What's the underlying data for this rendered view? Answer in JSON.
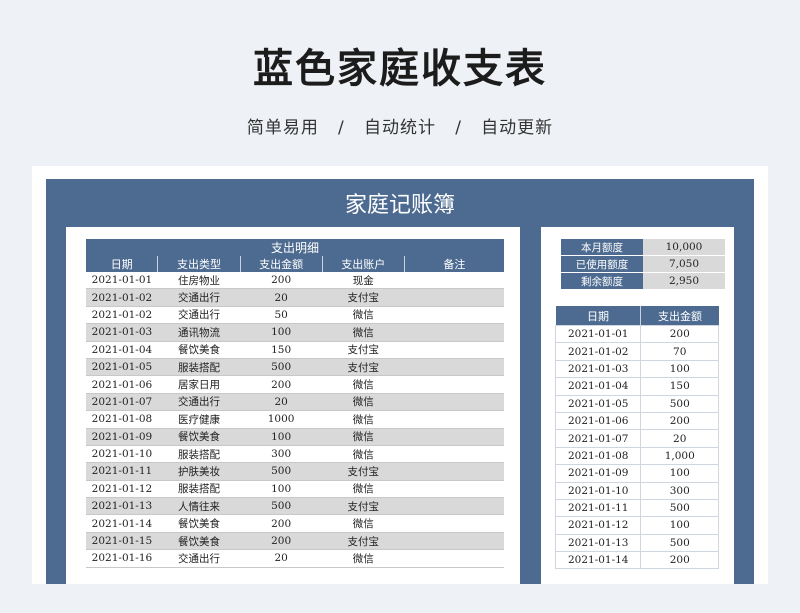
{
  "hero": {
    "title": "蓝色家庭收支表",
    "subtitle": "简单易用   /   自动统计   /   自动更新"
  },
  "sheet": {
    "title": "家庭记账簿"
  },
  "detail": {
    "title": "支出明细",
    "columns": [
      "日期",
      "支出类型",
      "支出金额",
      "支出账户",
      "备注"
    ],
    "rows": [
      [
        "2021-01-01",
        "住房物业",
        "200",
        "现金",
        ""
      ],
      [
        "2021-01-02",
        "交通出行",
        "20",
        "支付宝",
        ""
      ],
      [
        "2021-01-02",
        "交通出行",
        "50",
        "微信",
        ""
      ],
      [
        "2021-01-03",
        "通讯物流",
        "100",
        "微信",
        ""
      ],
      [
        "2021-01-04",
        "餐饮美食",
        "150",
        "支付宝",
        ""
      ],
      [
        "2021-01-05",
        "服装搭配",
        "500",
        "支付宝",
        ""
      ],
      [
        "2021-01-06",
        "居家日用",
        "200",
        "微信",
        ""
      ],
      [
        "2021-01-07",
        "交通出行",
        "20",
        "微信",
        ""
      ],
      [
        "2021-01-08",
        "医疗健康",
        "1000",
        "微信",
        ""
      ],
      [
        "2021-01-09",
        "餐饮美食",
        "100",
        "微信",
        ""
      ],
      [
        "2021-01-10",
        "服装搭配",
        "300",
        "微信",
        ""
      ],
      [
        "2021-01-11",
        "护肤美妆",
        "500",
        "支付宝",
        ""
      ],
      [
        "2021-01-12",
        "服装搭配",
        "100",
        "微信",
        ""
      ],
      [
        "2021-01-13",
        "人情往来",
        "500",
        "支付宝",
        ""
      ],
      [
        "2021-01-14",
        "餐饮美食",
        "200",
        "微信",
        ""
      ],
      [
        "2021-01-15",
        "餐饮美食",
        "200",
        "支付宝",
        ""
      ],
      [
        "2021-01-16",
        "交通出行",
        "20",
        "微信",
        ""
      ]
    ]
  },
  "quota": {
    "monthly_label": "本月额度",
    "monthly_value": "10,000",
    "used_label": "已使用额度",
    "used_value": "7,050",
    "remaining_label": "剩余额度",
    "remaining_value": "2,950"
  },
  "summary": {
    "columns": [
      "日期",
      "支出金额"
    ],
    "rows": [
      [
        "2021-01-01",
        "200"
      ],
      [
        "2021-01-02",
        "70"
      ],
      [
        "2021-01-03",
        "100"
      ],
      [
        "2021-01-04",
        "150"
      ],
      [
        "2021-01-05",
        "500"
      ],
      [
        "2021-01-06",
        "200"
      ],
      [
        "2021-01-07",
        "20"
      ],
      [
        "2021-01-08",
        "1,000"
      ],
      [
        "2021-01-09",
        "100"
      ],
      [
        "2021-01-10",
        "300"
      ],
      [
        "2021-01-11",
        "500"
      ],
      [
        "2021-01-12",
        "100"
      ],
      [
        "2021-01-13",
        "500"
      ],
      [
        "2021-01-14",
        "200"
      ]
    ]
  }
}
